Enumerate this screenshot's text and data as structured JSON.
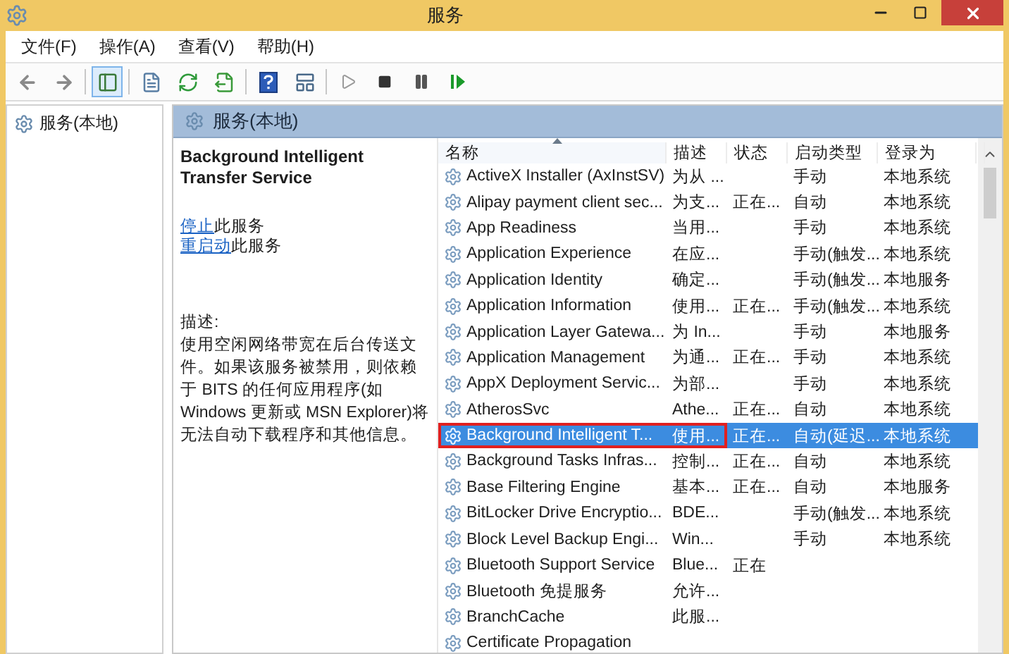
{
  "window": {
    "title": "服务"
  },
  "menu": [
    "文件(F)",
    "操作(A)",
    "查看(V)",
    "帮助(H)"
  ],
  "toolbar": [
    [
      {
        "kind": "back",
        "pressed": false
      },
      {
        "kind": "forward",
        "pressed": false
      }
    ],
    [
      {
        "kind": "tree",
        "pressed": true
      }
    ],
    [
      {
        "kind": "properties",
        "pressed": false
      },
      {
        "kind": "refresh",
        "pressed": false
      },
      {
        "kind": "export",
        "pressed": false
      }
    ],
    [
      {
        "kind": "help",
        "pressed": false
      },
      {
        "kind": "view",
        "pressed": false
      }
    ],
    [
      {
        "kind": "start",
        "pressed": false
      },
      {
        "kind": "stop",
        "pressed": false
      },
      {
        "kind": "pause",
        "pressed": false
      },
      {
        "kind": "resume",
        "pressed": false
      }
    ]
  ],
  "tree": [
    {
      "label": "服务(本地)"
    }
  ],
  "panel": {
    "title": "服务(本地)"
  },
  "details": {
    "service_name": "Background Intelligent Transfer Service",
    "actions": [
      {
        "link": "停止",
        "text": "此服务"
      },
      {
        "link": "重启动",
        "text": "此服务"
      }
    ],
    "description_label": "描述:",
    "description": "使用空闲网络带宽在后台传送文件。如果该服务被禁用，则依赖于 BITS 的任何应用程序(如 Windows 更新或 MSN Explorer)将无法自动下载程序和其他信息。"
  },
  "table": {
    "columns": [
      {
        "label": "名称",
        "sorted": true
      },
      {
        "label": "描述",
        "sorted": false
      },
      {
        "label": "状态",
        "sorted": false
      },
      {
        "label": "启动类型",
        "sorted": false
      },
      {
        "label": "登录为",
        "sorted": false
      }
    ],
    "rows": [
      {
        "name": "ActiveX Installer (AxInstSV)",
        "description": "为从 ...",
        "status": "",
        "startup": "手动",
        "logon": "本地系统",
        "selected": false,
        "highlighted": false
      },
      {
        "name": "Alipay payment client sec...",
        "description": "为支...",
        "status": "正在...",
        "startup": "自动",
        "logon": "本地系统",
        "selected": false,
        "highlighted": false
      },
      {
        "name": "App Readiness",
        "description": "当用...",
        "status": "",
        "startup": "手动",
        "logon": "本地系统",
        "selected": false,
        "highlighted": false
      },
      {
        "name": "Application Experience",
        "description": "在应...",
        "status": "",
        "startup": "手动(触发...",
        "logon": "本地系统",
        "selected": false,
        "highlighted": false
      },
      {
        "name": "Application Identity",
        "description": "确定...",
        "status": "",
        "startup": "手动(触发...",
        "logon": "本地服务",
        "selected": false,
        "highlighted": false
      },
      {
        "name": "Application Information",
        "description": "使用...",
        "status": "正在...",
        "startup": "手动(触发...",
        "logon": "本地系统",
        "selected": false,
        "highlighted": false
      },
      {
        "name": "Application Layer Gatewa...",
        "description": "为 In...",
        "status": "",
        "startup": "手动",
        "logon": "本地服务",
        "selected": false,
        "highlighted": false
      },
      {
        "name": "Application Management",
        "description": "为通...",
        "status": "正在...",
        "startup": "手动",
        "logon": "本地系统",
        "selected": false,
        "highlighted": false
      },
      {
        "name": "AppX Deployment Servic...",
        "description": "为部...",
        "status": "",
        "startup": "手动",
        "logon": "本地系统",
        "selected": false,
        "highlighted": false
      },
      {
        "name": "AtherosSvc",
        "description": "Athe...",
        "status": "正在...",
        "startup": "自动",
        "logon": "本地系统",
        "selected": false,
        "highlighted": false
      },
      {
        "name": "Background Intelligent T...",
        "description": "使用...",
        "status": "正在...",
        "startup": "自动(延迟...",
        "logon": "本地系统",
        "selected": true,
        "highlighted": true
      },
      {
        "name": "Background Tasks Infras...",
        "description": "控制...",
        "status": "正在...",
        "startup": "自动",
        "logon": "本地系统",
        "selected": false,
        "highlighted": false
      },
      {
        "name": "Base Filtering Engine",
        "description": "基本...",
        "status": "正在...",
        "startup": "自动",
        "logon": "本地服务",
        "selected": false,
        "highlighted": false
      },
      {
        "name": "BitLocker Drive Encryptio...",
        "description": "BDE...",
        "status": "",
        "startup": "手动(触发...",
        "logon": "本地系统",
        "selected": false,
        "highlighted": false
      },
      {
        "name": "Block Level Backup Engi...",
        "description": "Win...",
        "status": "",
        "startup": "手动",
        "logon": "本地系统",
        "selected": false,
        "highlighted": false
      },
      {
        "name": "Bluetooth Support Service",
        "description": "Blue...",
        "status": "正在",
        "startup": "",
        "logon": "",
        "selected": false,
        "highlighted": false
      },
      {
        "name": "Bluetooth 免提服务",
        "description": "允许...",
        "status": "",
        "startup": "",
        "logon": "",
        "selected": false,
        "highlighted": false
      },
      {
        "name": "BranchCache",
        "description": "此服...",
        "status": "",
        "startup": "",
        "logon": "",
        "selected": false,
        "highlighted": false
      },
      {
        "name": "Certificate Propagation",
        "description": "",
        "status": "",
        "startup": "",
        "logon": "",
        "selected": false,
        "highlighted": false
      }
    ]
  }
}
